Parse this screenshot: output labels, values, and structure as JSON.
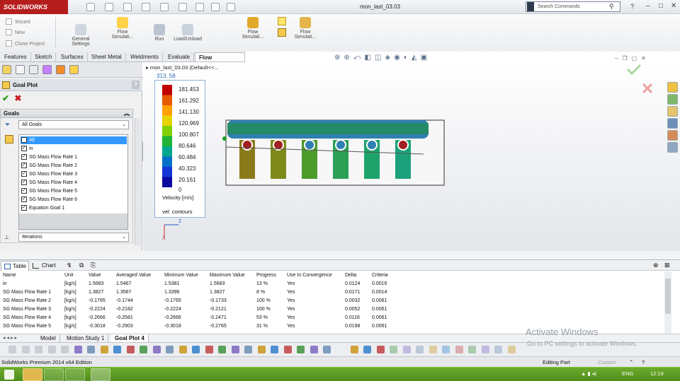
{
  "app": {
    "logo_text": "SOLIDWORKS",
    "document_title": "mon_last_03.03"
  },
  "search": {
    "placeholder": "Search Commands"
  },
  "window_buttons": {
    "minimize": "–",
    "restore": "□",
    "close": "✕"
  },
  "cmd_small": [
    "Wizard",
    "New",
    "Clone Project"
  ],
  "cmd_big": [
    {
      "label": "General\nSettings"
    },
    {
      "label": "Flow\nSimulati..."
    },
    {
      "label": "Run"
    },
    {
      "label": "Load/Unload"
    },
    {
      "label": "Flow\nSimulati..."
    },
    {
      "label": "Flow\nSimulati..."
    }
  ],
  "tabs": [
    "Features",
    "Sketch",
    "Surfaces",
    "Sheet Metal",
    "Weldments",
    "Evaluate",
    "Flow Simulation"
  ],
  "active_tab": "Flow Simulation",
  "goal_plot": {
    "title": "Goal Plot",
    "help": "?",
    "goals_header": "Goals",
    "filter": "All Goals",
    "items": [
      {
        "label": "All",
        "checked": true,
        "selected": true
      },
      {
        "label": "in",
        "checked": true
      },
      {
        "label": "SG Mass Flow Rate 1",
        "checked": true
      },
      {
        "label": "SG Mass Flow Rate 2",
        "checked": true
      },
      {
        "label": "SG Mass Flow Rate 3",
        "checked": true
      },
      {
        "label": "SG Mass Flow Rate 4",
        "checked": true
      },
      {
        "label": "SG Mass Flow Rate 5",
        "checked": true
      },
      {
        "label": "SG Mass Flow Rate 6",
        "checked": true
      },
      {
        "label": "Equation Goal 1",
        "checked": true
      }
    ],
    "xaxis_select": "Iterations"
  },
  "viewport": {
    "tree_header": "mon_last_03.03  (Default<<...",
    "coord": "313, 58",
    "legend": {
      "values": [
        "181.453",
        "161.292",
        "141.130",
        "120.969",
        "100.807",
        "80.646",
        "60.484",
        "40.323",
        "20.161",
        "0"
      ],
      "colors": [
        "#c00000",
        "#e85a00",
        "#ff9f00",
        "#e6d400",
        "#84d000",
        "#1fb437",
        "#00a690",
        "#0070c8",
        "#1337d6",
        "#0a0a9f"
      ],
      "unit_label": "Velocity [m/s]",
      "plot_type": "vel: contours"
    },
    "axis_labels": {
      "z": "Z",
      "x": "X"
    }
  },
  "bottom_tabs": {
    "table": "Table",
    "chart": "Chart"
  },
  "table": {
    "headers": [
      "Name",
      "Unit",
      "Value",
      "Averaged Value",
      "Minimum Value",
      "Maximum Value",
      "Progress",
      "Use In Convergence",
      "Delta",
      "Criteria"
    ],
    "rows": [
      [
        "in",
        "[kg/s]",
        "1.5683",
        "1.5467",
        "1.5381",
        "1.5683",
        "13 %",
        "Yes",
        "0.0124",
        "0.0016"
      ],
      [
        "SG Mass Flow Rate 1",
        "[kg/s]",
        "1.3827",
        "1.3567",
        "1.3396",
        "1.3827",
        "8 %",
        "Yes",
        "0.0171",
        "0.0014"
      ],
      [
        "SG Mass Flow Rate 2",
        "[kg/s]",
        "-0.1765",
        "-0.1744",
        "-0.1765",
        "-0.1733",
        "100 %",
        "Yes",
        "0.0032",
        "0.0061"
      ],
      [
        "SG Mass Flow Rate 3",
        "[kg/s]",
        "-0.2224",
        "-0.2182",
        "-0.2224",
        "-0.2121",
        "100 %",
        "Yes",
        "0.0052",
        "0.0061"
      ],
      [
        "SG Mass Flow Rate 4",
        "[kg/s]",
        "-0.2666",
        "-0.2581",
        "-0.2666",
        "-0.2471",
        "53 %",
        "Yes",
        "0.0116",
        "0.0061"
      ],
      [
        "SG Mass Flow Rate 5",
        "[kg/s]",
        "-0.3018",
        "-0.2903",
        "-0.3018",
        "-0.2765",
        "31 %",
        "Yes",
        "0.0198",
        "0.0061"
      ]
    ]
  },
  "study_tabs": [
    "Model",
    "Motion Study 1",
    "Goal Plot 4"
  ],
  "active_study_tab": "Goal Plot 4",
  "watermark": {
    "line1": "Activate Windows",
    "line2": "Go to PC settings to activate Windows."
  },
  "status": {
    "left": "SolidWorks Premium 2014 x64 Edition",
    "editing": "Editing Part",
    "custom": "Custom",
    "help": "?"
  },
  "taskbar": {
    "lang": "ENG",
    "time": "12:19"
  }
}
